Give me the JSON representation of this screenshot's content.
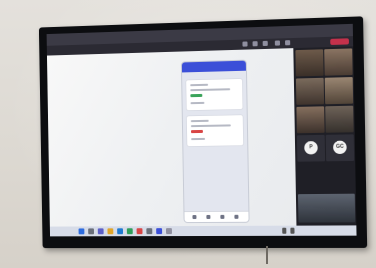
{
  "colors": {
    "wall": "#e0ddd7",
    "tv_bezel": "#0c0d10",
    "meeting_toolbar": "#2b2a33",
    "leave_button": "#c4314b",
    "phone_app_bar": "#3b4fd8",
    "green_status": "#3aa35a",
    "red_status": "#d84545"
  },
  "icons": [
    "camera-icon",
    "microphone-icon",
    "share-icon",
    "people-icon",
    "chat-icon",
    "start-icon",
    "search-icon",
    "wifi-icon",
    "speaker-icon"
  ],
  "meeting": {
    "leave_label": ""
  },
  "gallery": {
    "avatars": [
      {
        "initials": "P",
        "color": "#f1f1f1"
      },
      {
        "initials": "GC",
        "color": "#f1f1f1"
      }
    ]
  }
}
